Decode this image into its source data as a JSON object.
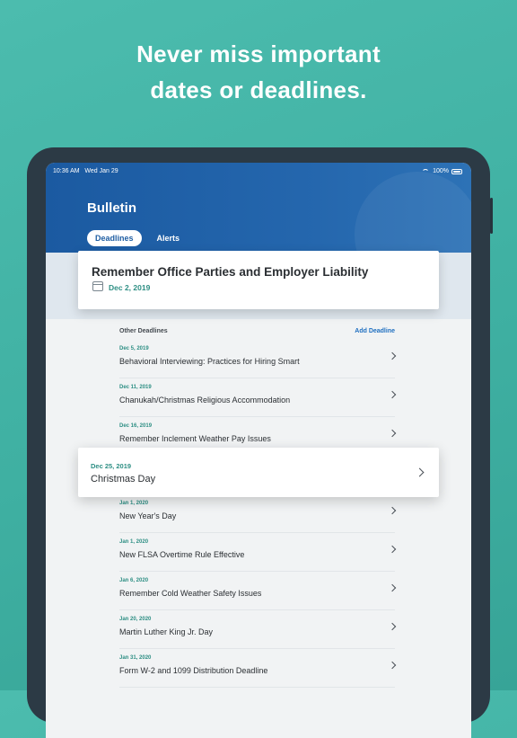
{
  "headline": {
    "line1": "Never miss important",
    "line2": "dates or deadlines."
  },
  "status_bar": {
    "time": "10:36 AM",
    "day": "Wed Jan 29",
    "battery": "100%"
  },
  "app": {
    "title": "Bulletin"
  },
  "tabs": [
    {
      "label": "Deadlines",
      "active": true
    },
    {
      "label": "Alerts",
      "active": false
    }
  ],
  "featured": {
    "title": "Remember Office Parties and Employer Liability",
    "date": "Dec 2, 2019"
  },
  "list": {
    "header": "Other Deadlines",
    "add_label": "Add Deadline",
    "items": [
      {
        "date": "Dec 5, 2019",
        "title": "Behavioral Interviewing: Practices for Hiring Smart"
      },
      {
        "date": "Dec 11, 2019",
        "title": "Chanukah/Christmas Religious Accommodation"
      },
      {
        "date": "Dec 16, 2019",
        "title": "Remember Inclement Weather Pay Issues"
      },
      {
        "date": "Dec 25, 2019",
        "title": "Christmas Day"
      },
      {
        "date": "Jan 1, 2020",
        "title": "New Year's Day"
      },
      {
        "date": "Jan 1, 2020",
        "title": "New FLSA Overtime Rule Effective"
      },
      {
        "date": "Jan 6, 2020",
        "title": "Remember Cold Weather Safety Issues"
      },
      {
        "date": "Jan 20, 2020",
        "title": "Martin Luther King Jr. Day"
      },
      {
        "date": "Jan 31, 2020",
        "title": "Form W-2 and 1099 Distribution Deadline"
      }
    ]
  },
  "colors": {
    "background": "#43b5a7",
    "header_blue": "#1f5ea3",
    "accent_teal": "#2e8f84",
    "link_blue": "#1f6fc0"
  },
  "icons": [
    "wifi-icon",
    "battery-icon",
    "calendar-icon",
    "chevron-right-icon"
  ]
}
